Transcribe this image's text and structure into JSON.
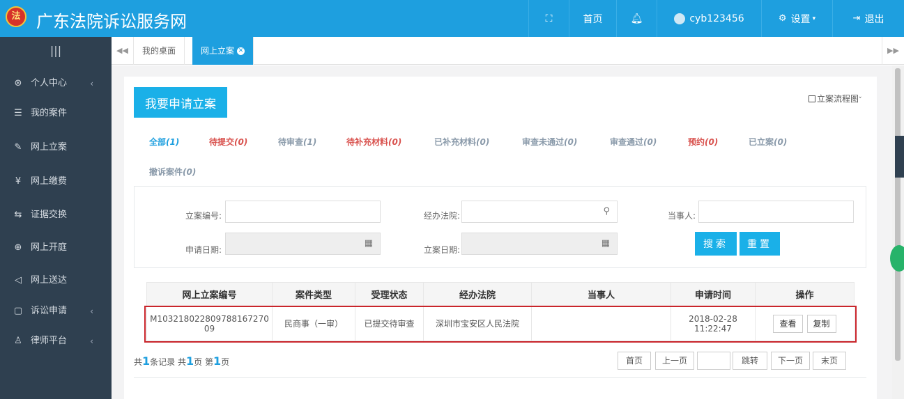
{
  "header": {
    "logo_text": "法",
    "title": "广东法院诉讼服务网",
    "fullscreen_icon": "expand-icon",
    "home_label": "首页",
    "bell_icon": "bell-icon",
    "username": "cyb123456",
    "settings_label": "设置",
    "logout_label": "退出"
  },
  "tabs": {
    "toggle_icon": "menu-bars-icon",
    "items": [
      {
        "label": "我的桌面",
        "active": false
      },
      {
        "label": "网上立案",
        "active": true
      }
    ]
  },
  "sidebar": {
    "items": [
      {
        "label": "个人中心",
        "icon": "user-circle-icon",
        "submenu": true
      },
      {
        "label": "我的案件",
        "icon": "list-icon",
        "submenu": false
      },
      {
        "label": "网上立案",
        "icon": "edit-icon",
        "submenu": false
      },
      {
        "label": "网上缴费",
        "icon": "yen-icon",
        "submenu": false
      },
      {
        "label": "证据交换",
        "icon": "exchange-icon",
        "submenu": false
      },
      {
        "label": "网上开庭",
        "icon": "globe-icon",
        "submenu": false
      },
      {
        "label": "网上送达",
        "icon": "send-icon",
        "submenu": false
      },
      {
        "label": "诉讼申请",
        "icon": "document-icon",
        "submenu": true
      },
      {
        "label": "律师平台",
        "icon": "users-icon",
        "submenu": true
      }
    ]
  },
  "main": {
    "apply_button": "我要申请立案",
    "flow_link": "立案流程图",
    "filter_tabs": [
      {
        "label": "全部",
        "count": "(1)",
        "style": "active"
      },
      {
        "label": "待提交",
        "count": "(0)",
        "style": "red"
      },
      {
        "label": "待审查",
        "count": "(1)",
        "style": "gray"
      },
      {
        "label": "待补充材料",
        "count": "(0)",
        "style": "red"
      },
      {
        "label": "已补充材料",
        "count": "(0)",
        "style": "gray"
      },
      {
        "label": "审查未通过",
        "count": "(0)",
        "style": "gray"
      },
      {
        "label": "审查通过",
        "count": "(0)",
        "style": "gray"
      },
      {
        "label": "预约",
        "count": "(0)",
        "style": "red"
      },
      {
        "label": "已立案",
        "count": "(0)",
        "style": "gray"
      },
      {
        "label": "撤诉案件",
        "count": "(0)",
        "style": "gray"
      }
    ],
    "search": {
      "case_no_label": "立案编号:",
      "court_label": "经办法院:",
      "party_label": "当事人:",
      "apply_date_label": "申请日期:",
      "filing_date_label": "立案日期:",
      "search_button": "搜索",
      "reset_button": "重置"
    },
    "table": {
      "headers": [
        "网上立案编号",
        "案件类型",
        "受理状态",
        "经办法院",
        "当事人",
        "申请时间",
        "操作"
      ],
      "rows": [
        {
          "case_no": "M103218022809788167270​09",
          "type": "民商事（一审）",
          "status": "已提交待审查",
          "court": "深圳市宝安区人民法院",
          "party": "",
          "date": "2018-02-28",
          "time": "11:22:47",
          "view": "查看",
          "copy": "复制"
        }
      ]
    },
    "pager": {
      "prefix": "共",
      "records": "1",
      "records_suffix": "条记录 共",
      "pages": "1",
      "pages_suffix": "页 第",
      "current": "1",
      "current_suffix": "页",
      "first": "首页",
      "prev": "上一页",
      "jump": "跳转",
      "next": "下一页",
      "last": "末页"
    }
  },
  "colors": {
    "header": "#1e9fdf",
    "sidebar": "#2f4050",
    "accent_red": "#d9534f",
    "highlight_box": "#c9252b"
  }
}
